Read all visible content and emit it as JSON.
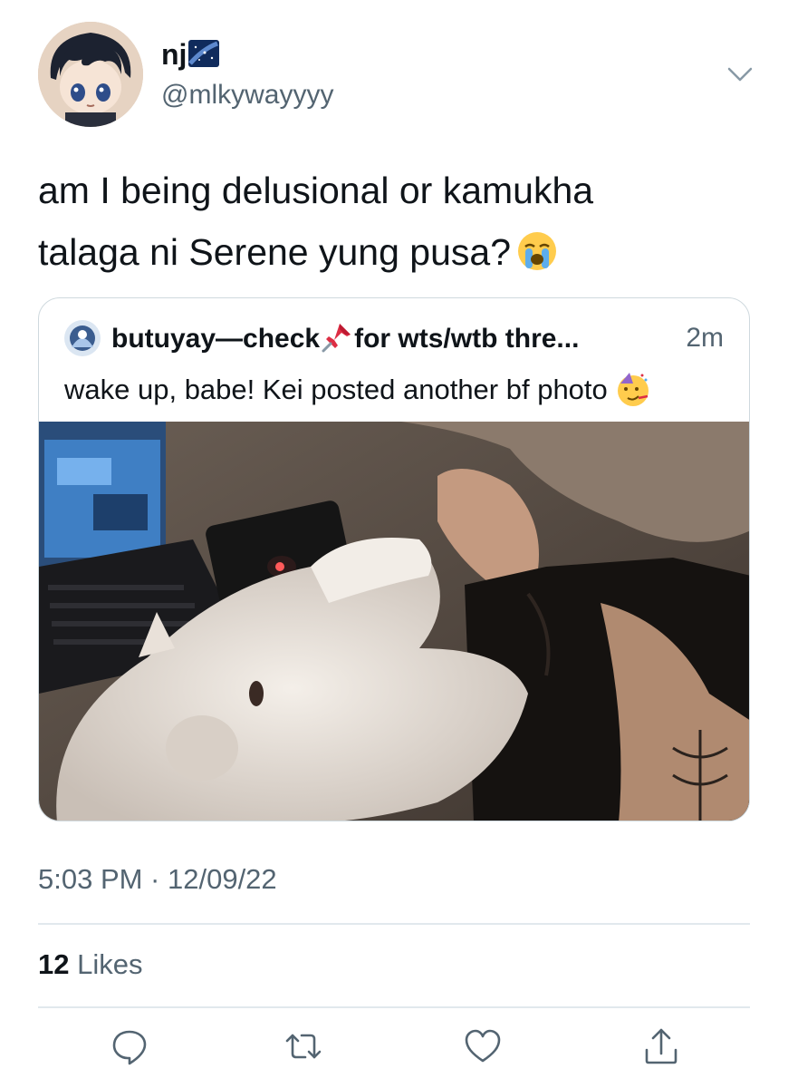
{
  "author": {
    "display_name": "nj",
    "name_emoji": "milky-way-emoji",
    "handle": "@mlkywayyyy",
    "avatar": "anime-boy-avatar"
  },
  "tweet": {
    "text_line1": "am I being delusional or kamukha",
    "text_line2": "talaga ni Serene yung pusa?",
    "emoji": "loudly-crying-face-emoji"
  },
  "quoted_tweet": {
    "name_part1": "butuyay—check",
    "name_emoji": "pushpin-emoji",
    "name_part2": "for wts/wtb thre...",
    "time": "2m",
    "text": "wake up, babe! Kei posted another bf photo",
    "text_emoji": "partying-face-emoji",
    "photo": "person-with-white-cat-photo"
  },
  "meta": {
    "timestamp": "5:03 PM · 12/09/22",
    "likes_count": "12",
    "likes_label": "Likes"
  },
  "actions": {
    "reply_icon": "reply-icon",
    "retweet_icon": "retweet-icon",
    "like_icon": "heart-icon",
    "share_icon": "share-icon"
  },
  "colors": {
    "text": "#0f1419",
    "secondary": "#536471",
    "border": "#cfd9de"
  }
}
